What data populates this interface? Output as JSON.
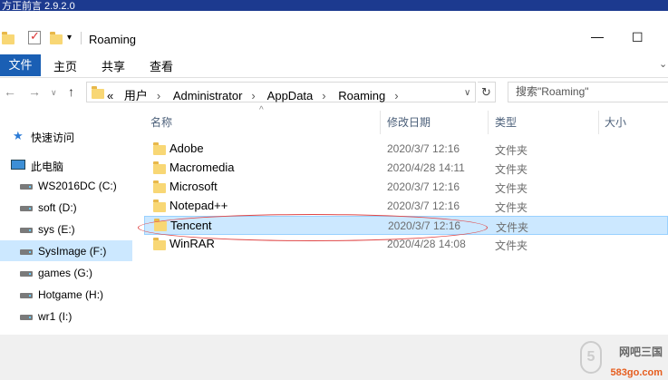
{
  "top_strip_text": "方正前言 2.9.2.0",
  "window": {
    "title": "Roaming",
    "minimize": "—",
    "maximize": "☐"
  },
  "ribbon": {
    "tabs": [
      {
        "label": "文件"
      },
      {
        "label": "主页"
      },
      {
        "label": "共享"
      },
      {
        "label": "查看"
      }
    ]
  },
  "address": {
    "overflow": "«",
    "crumbs": [
      "用户",
      "Administrator",
      "AppData",
      "Roaming"
    ],
    "search_placeholder": "搜索\"Roaming\""
  },
  "nav": {
    "quick_access": "快速访问",
    "this_pc": "此电脑",
    "drives": [
      {
        "label": "WS2016DC (C:)"
      },
      {
        "label": "soft (D:)"
      },
      {
        "label": "sys (E:)"
      },
      {
        "label": "SysImage (F:)",
        "selected": true
      },
      {
        "label": "games (G:)"
      },
      {
        "label": "Hotgame (H:)"
      },
      {
        "label": "wr1 (I:)"
      }
    ]
  },
  "columns": {
    "name": "名称",
    "date": "修改日期",
    "type": "类型",
    "size": "大小"
  },
  "files": [
    {
      "name": "Adobe",
      "date": "2020/3/7 12:16",
      "type": "文件夹"
    },
    {
      "name": "Macromedia",
      "date": "2020/4/28 14:11",
      "type": "文件夹"
    },
    {
      "name": "Microsoft",
      "date": "2020/3/7 12:16",
      "type": "文件夹"
    },
    {
      "name": "Notepad++",
      "date": "2020/3/7 12:16",
      "type": "文件夹"
    },
    {
      "name": "Tencent",
      "date": "2020/3/7 12:16",
      "type": "文件夹",
      "highlighted": true
    },
    {
      "name": "WinRAR",
      "date": "2020/4/28 14:08",
      "type": "文件夹"
    }
  ],
  "watermark": {
    "digit": "5",
    "brand": "网吧三国",
    "domain": "583go.com"
  },
  "colors": {
    "accent": "#1a5fb4",
    "selection": "#cce8ff",
    "annotation": "#e04848",
    "folder": "#f8d775"
  }
}
